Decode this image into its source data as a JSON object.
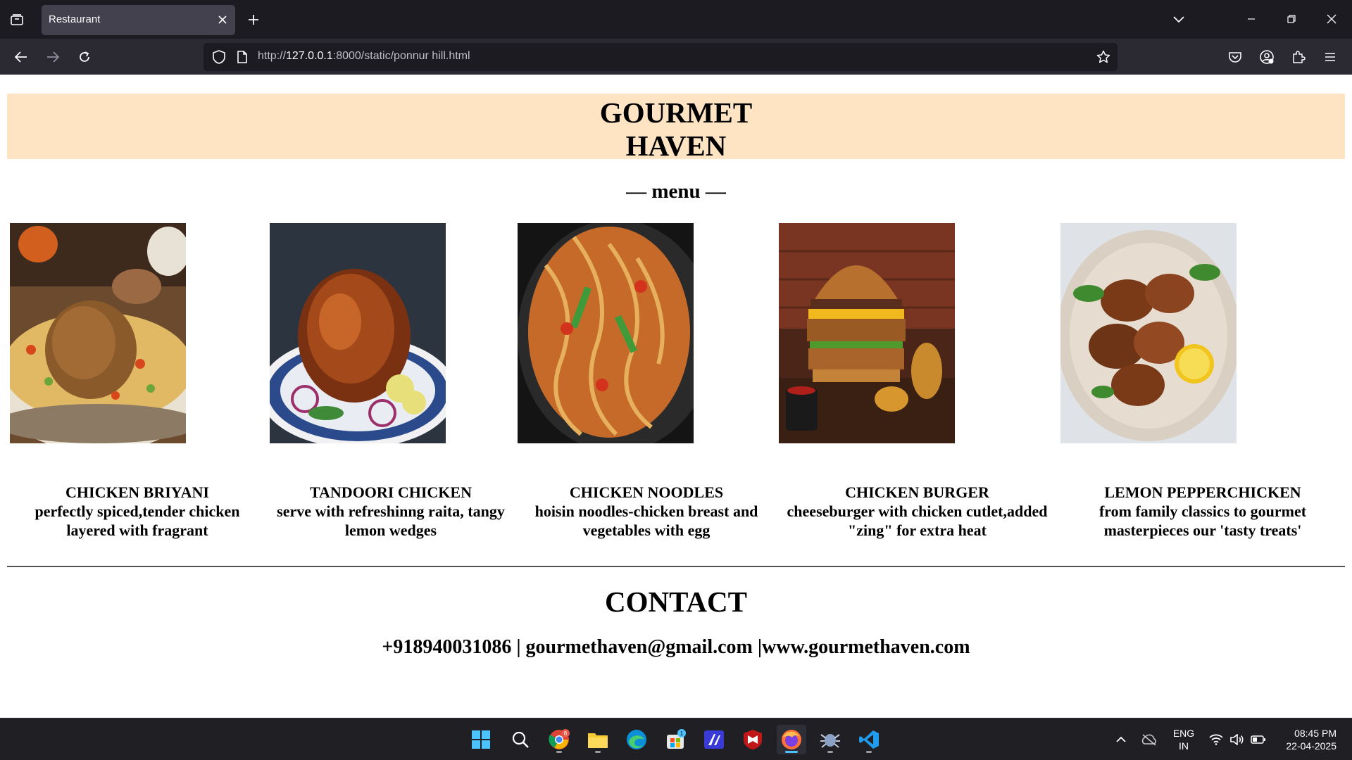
{
  "browser": {
    "tab_title": "Restaurant",
    "url_prefix": "http://",
    "url_host": "127.0.0.1",
    "url_rest": ":8000/static/ponnur hill.html"
  },
  "page": {
    "brand": "GOURMET HAVEN",
    "menu_heading": "— menu —",
    "dishes": [
      {
        "name": "CHICKEN BRIYANI",
        "description": "perfectly spiced,tender chicken layered with fragrant"
      },
      {
        "name": "TANDOORI CHICKEN",
        "description": "serve with refreshinng raita, tangy lemon wedges"
      },
      {
        "name": "CHICKEN NOODLES",
        "description": "hoisin noodles-chicken breast and vegetables with egg"
      },
      {
        "name": "CHICKEN BURGER",
        "description": "cheeseburger with chicken cutlet,added \"zing\" for extra heat"
      },
      {
        "name": "LEMON PEPPERCHICKEN",
        "description": "from family classics to gourmet masterpieces our 'tasty treats'"
      }
    ],
    "contact_title": "CONTACT",
    "contact_info": "+918940031086 | gourmethaven@gmail.com |www.gourmethaven.com"
  },
  "taskbar": {
    "chrome_badge": "8",
    "store_badge": "1",
    "lang_line1": "ENG",
    "lang_line2": "IN",
    "time": "08:45 PM",
    "date": "22-04-2025"
  },
  "colors": {
    "banner_bg": "#ffe4c4",
    "chrome_dark": "#1c1b22",
    "toolbar": "#2b2a33",
    "active_tab": "#42414d",
    "taskbar": "#1f1f24"
  },
  "icons": [
    "tab-list-icon",
    "close-icon",
    "plus-icon",
    "chevron-down-icon",
    "minimize-icon",
    "restore-icon",
    "back-arrow-icon",
    "forward-arrow-icon",
    "reload-icon",
    "shield-icon",
    "page-icon",
    "star-icon",
    "pocket-icon",
    "account-icon",
    "extensions-icon",
    "hamburger-menu-icon",
    "windows-start-icon",
    "search-icon",
    "chrome-icon",
    "file-explorer-icon",
    "edge-icon",
    "ms-store-icon",
    "app-icon",
    "mcafee-icon",
    "firefox-icon",
    "bug-app-icon",
    "vscode-icon",
    "chevron-up-icon",
    "onedrive-icon",
    "wifi-icon",
    "volume-icon",
    "battery-icon"
  ]
}
